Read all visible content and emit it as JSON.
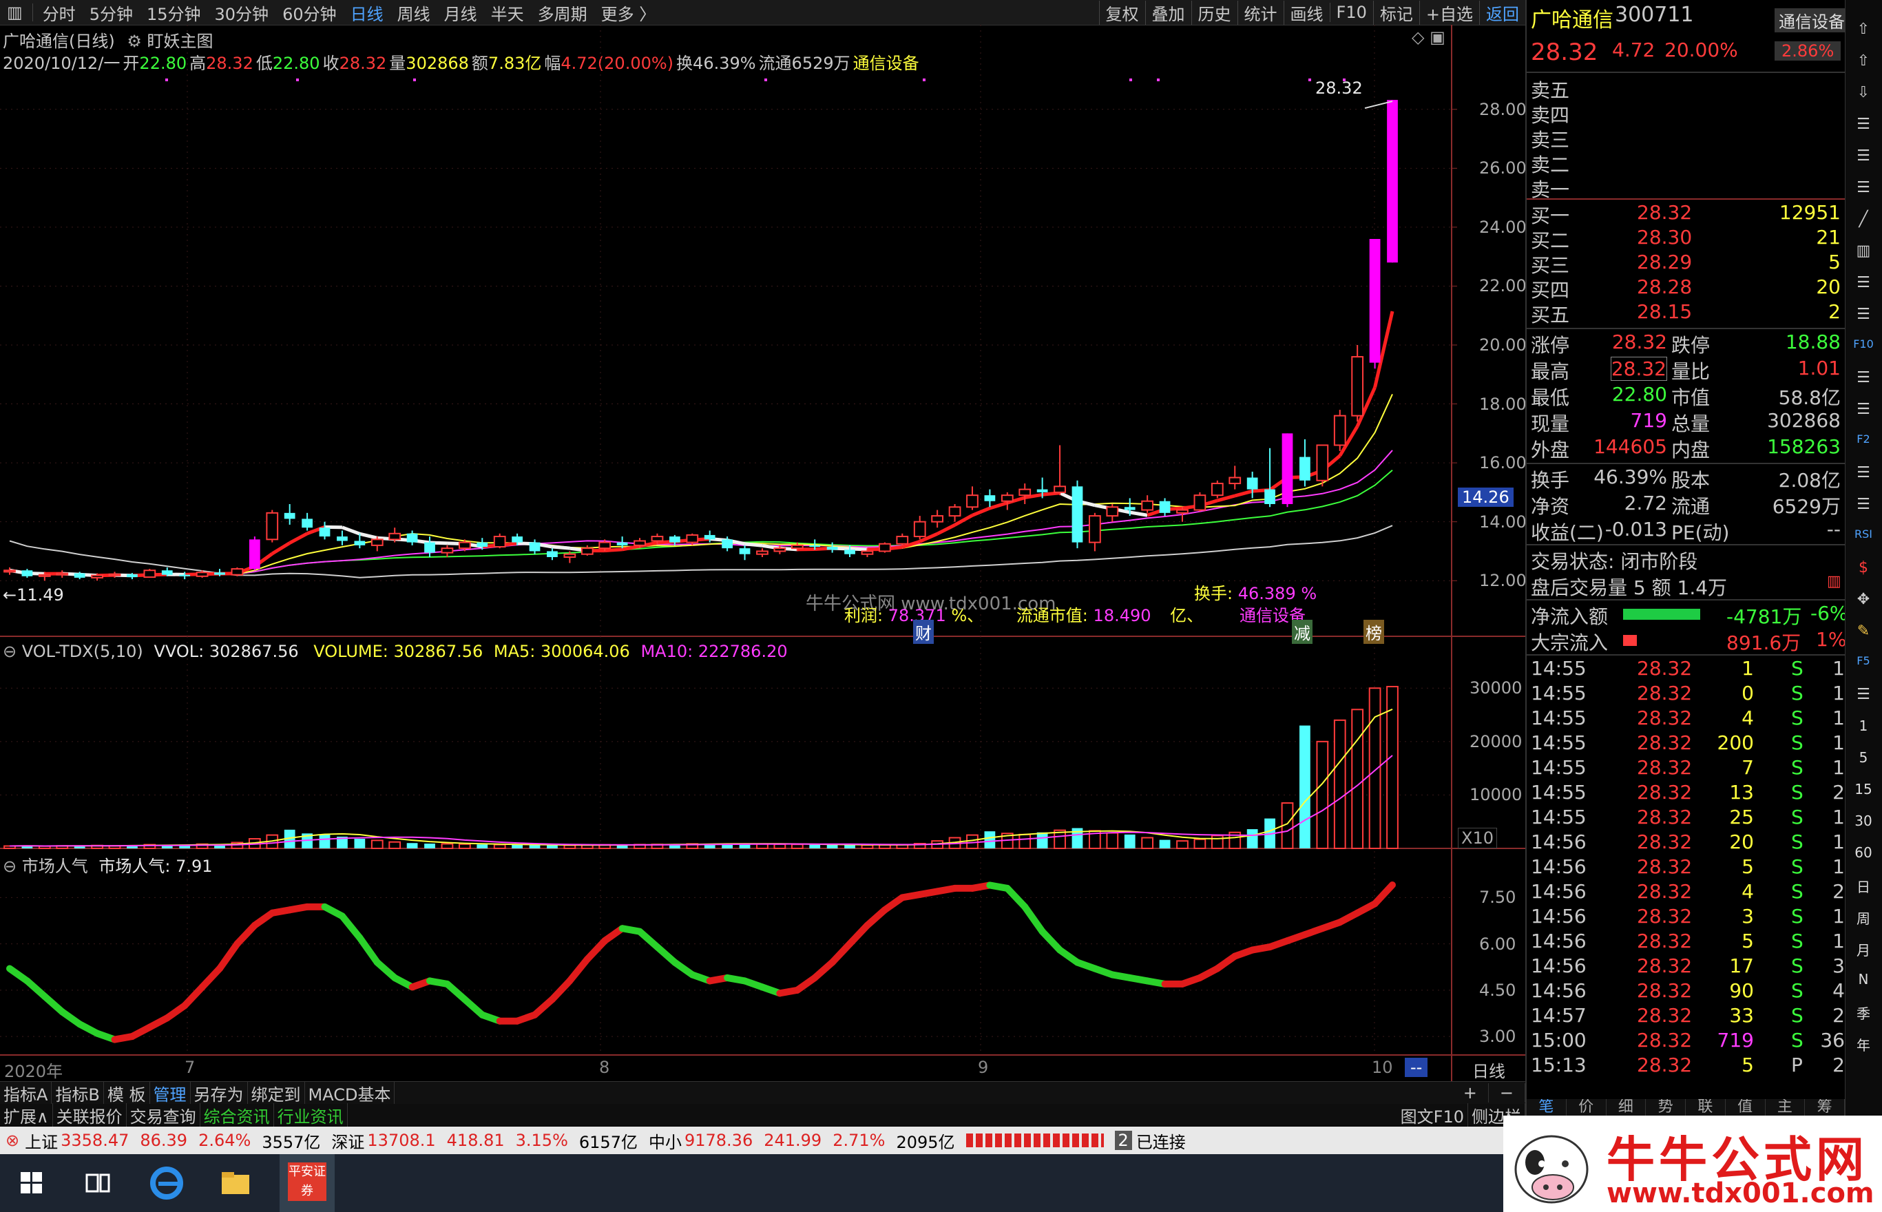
{
  "menu": {
    "left_icon": "▥",
    "tabs": [
      "分时",
      "5分钟",
      "15分钟",
      "30分钟",
      "60分钟",
      "日线",
      "周线",
      "月线",
      "半天",
      "多周期",
      "更多 〉"
    ],
    "active": "日线",
    "tools": [
      "复权",
      "叠加",
      "历史",
      "统计",
      "画线",
      "F10",
      "标记",
      "+自选",
      "返回"
    ]
  },
  "chart": {
    "title": "广哈通信(日线)",
    "indicator": "盯妖主图",
    "info": {
      "date": "2020/10/12/一",
      "open_label": "开",
      "open": "22.80",
      "high_label": "高",
      "high": "28.32",
      "low_label": "低",
      "low": "22.80",
      "close_label": "收",
      "close": "28.32",
      "vol_label": "量",
      "vol": "302868",
      "amt_label": "额",
      "amt": "7.83亿",
      "amp_label": "幅",
      "amp": "4.72(20.00%)",
      "turnover": "换46.39%",
      "float": "流通6529万",
      "sector": "通信设备"
    },
    "price_ticks": [
      "28.00",
      "26.00",
      "24.00",
      "22.00",
      "20.00",
      "18.00",
      "16.00",
      "14.00",
      "12.00"
    ],
    "current_price_tag": "14.26",
    "max_label": "28.32",
    "min_label": "11.49",
    "overlay": {
      "profit_label": "利润:",
      "profit": "78.371",
      "profit_unit": "%、",
      "float_cap_label": "流通市值:",
      "float_cap": "18.490",
      "float_cap_unit": "亿、",
      "turnover_label": "换手:",
      "turnover": "46.389",
      "turnover_unit": "%",
      "sector": "通信设备",
      "watermark": "牛牛公式网 www.tdx001.com",
      "tag_cai": "财",
      "tag_jian": "减",
      "tag_bang": "榜"
    }
  },
  "vol": {
    "name": "VOL-TDX(5,10)",
    "vvol": "VVOL: 302867.56",
    "volume": "VOLUME: 302867.56",
    "ma5": "MA5: 300064.06",
    "ma10": "MA10: 222786.20",
    "ticks": [
      "30000",
      "20000",
      "10000"
    ],
    "unit": "X10"
  },
  "pop": {
    "name": "市场人气",
    "value": "市场人气: 7.91",
    "ticks": [
      "7.50",
      "6.00",
      "4.50",
      "3.00"
    ]
  },
  "xaxis": {
    "labels": [
      "2020年",
      "7",
      "8",
      "9",
      "10"
    ],
    "end": "--"
  },
  "period_label": "日线",
  "bottom_tabs": [
    "指标A",
    "指标B",
    "模 板",
    "管理",
    "另存为",
    "绑定到",
    "MACD基本"
  ],
  "bottom_tabs_sel": "管理",
  "bottom_tabs2": [
    "扩展∧",
    "关联报价",
    "交易查询",
    "综合资讯",
    "行业资讯"
  ],
  "bottom_right": [
    "图文F10",
    "侧边栏"
  ],
  "plusminus": [
    "+",
    "−"
  ],
  "quote": {
    "name": "广哈通信",
    "code": "300711",
    "sector_btn": "通信设备",
    "price": "28.32",
    "chg": "4.72",
    "pct": "20.00%",
    "sector_pct": "2.86%",
    "asks": [
      "卖五",
      "卖四",
      "卖三",
      "卖二",
      "卖一"
    ],
    "bids": [
      {
        "l": "买一",
        "p": "28.32",
        "v": "12951"
      },
      {
        "l": "买二",
        "p": "28.30",
        "v": "21"
      },
      {
        "l": "买三",
        "p": "28.29",
        "v": "5"
      },
      {
        "l": "买四",
        "p": "28.28",
        "v": "20"
      },
      {
        "l": "买五",
        "p": "28.15",
        "v": "2"
      }
    ],
    "stats": [
      {
        "a": "涨停",
        "b": "28.32",
        "c": "跌停",
        "d": "18.88"
      },
      {
        "a": "最高",
        "b": "28.32",
        "c": "量比",
        "d": "1.01"
      },
      {
        "a": "最低",
        "b": "22.80",
        "c": "市值",
        "d": "58.8亿"
      },
      {
        "a": "现量",
        "b": "719",
        "c": "总量",
        "d": "302868"
      },
      {
        "a": "外盘",
        "b": "144605",
        "c": "内盘",
        "d": "158263"
      }
    ],
    "stats2": [
      {
        "a": "换手",
        "b": "46.39%",
        "c": "股本",
        "d": "2.08亿"
      },
      {
        "a": "净资",
        "b": "2.72",
        "c": "流通",
        "d": "6529万"
      },
      {
        "a": "收益(二)",
        "b": "-0.013",
        "c": "PE(动)",
        "d": "--"
      }
    ],
    "trade_status": "交易状态: 闭市阶段",
    "after_trade": "盘后交易量 5 额 1.4万",
    "netflow_label": "净流入额",
    "netflow": "-4781万",
    "netflow_pct": "-6%",
    "block_label": "大宗流入",
    "block": "891.6万",
    "block_pct": "1%",
    "ticks": [
      {
        "t": "14:55",
        "p": "28.32",
        "v": "1",
        "s": "S",
        "n": "1"
      },
      {
        "t": "14:55",
        "p": "28.32",
        "v": "0",
        "s": "S",
        "n": "1"
      },
      {
        "t": "14:55",
        "p": "28.32",
        "v": "4",
        "s": "S",
        "n": "1"
      },
      {
        "t": "14:55",
        "p": "28.32",
        "v": "200",
        "s": "S",
        "n": "1"
      },
      {
        "t": "14:55",
        "p": "28.32",
        "v": "7",
        "s": "S",
        "n": "1"
      },
      {
        "t": "14:55",
        "p": "28.32",
        "v": "13",
        "s": "S",
        "n": "2"
      },
      {
        "t": "14:55",
        "p": "28.32",
        "v": "25",
        "s": "S",
        "n": "1"
      },
      {
        "t": "14:56",
        "p": "28.32",
        "v": "20",
        "s": "S",
        "n": "1"
      },
      {
        "t": "14:56",
        "p": "28.32",
        "v": "5",
        "s": "S",
        "n": "1"
      },
      {
        "t": "14:56",
        "p": "28.32",
        "v": "4",
        "s": "S",
        "n": "2"
      },
      {
        "t": "14:56",
        "p": "28.32",
        "v": "3",
        "s": "S",
        "n": "1"
      },
      {
        "t": "14:56",
        "p": "28.32",
        "v": "5",
        "s": "S",
        "n": "1"
      },
      {
        "t": "14:56",
        "p": "28.32",
        "v": "17",
        "s": "S",
        "n": "3"
      },
      {
        "t": "14:56",
        "p": "28.32",
        "v": "90",
        "s": "S",
        "n": "4"
      },
      {
        "t": "14:57",
        "p": "28.32",
        "v": "33",
        "s": "S",
        "n": "2"
      },
      {
        "t": "15:00",
        "p": "28.32",
        "v": "719",
        "s": "S",
        "n": "36"
      },
      {
        "t": "15:13",
        "p": "28.32",
        "v": "5",
        "s": "P",
        "n": "2"
      }
    ],
    "bottom_tabs": [
      "笔",
      "价",
      "细",
      "势",
      "联",
      "值",
      "主",
      "筹"
    ]
  },
  "side_tools": [
    "⇧",
    "⇧",
    "⇩",
    "☰",
    "☰",
    "☰",
    "╱",
    "▥",
    "☰",
    "☰",
    "F10",
    "☰",
    "☰",
    "F2",
    "☰",
    "☰",
    "RSI",
    "$",
    "✥",
    "✎",
    "F5",
    "☰",
    "1",
    "5",
    "15",
    "30",
    "60",
    "日",
    "周",
    "月",
    "N",
    "季",
    "年"
  ],
  "status": {
    "sh_label": "上证",
    "sh": "3358.47",
    "sh_chg": "86.39",
    "sh_pct": "2.64%",
    "sh_amt": "3557亿",
    "sz_label": "深证",
    "sz": "13708.1",
    "sz_chg": "418.81",
    "sz_pct": "3.15%",
    "sz_amt": "6157亿",
    "zx_label": "中小",
    "zx": "9178.36",
    "zx_chg": "241.99",
    "zx_pct": "2.71%",
    "zx_amt": "2095亿",
    "conn_num": "2",
    "conn": "已连接"
  },
  "brand": {
    "name": "牛牛公式网",
    "url": "www.tdx001.com"
  },
  "taskbar": {
    "app_label": "平安证券"
  },
  "colors": {
    "up": "#ff3b3b",
    "down": "#54ffff",
    "ma_white": "#e8e8e8",
    "ma_yellow": "#ffff3c",
    "ma_magenta": "#ff3cff",
    "ma_green": "#3cff3c",
    "limit": "#ff00ff",
    "accent": "#4fa3ff"
  },
  "chart_data": {
    "type": "candlestick",
    "price_axis": [
      11,
      29
    ],
    "candles": [
      [
        12.3,
        12.45,
        12.2,
        12.35
      ],
      [
        12.35,
        12.4,
        12.1,
        12.15
      ],
      [
        12.15,
        12.3,
        12.0,
        12.2
      ],
      [
        12.2,
        12.35,
        12.1,
        12.25
      ],
      [
        12.25,
        12.3,
        12.05,
        12.1
      ],
      [
        12.1,
        12.25,
        12.0,
        12.18
      ],
      [
        12.18,
        12.3,
        12.1,
        12.22
      ],
      [
        12.22,
        12.26,
        12.05,
        12.12
      ],
      [
        12.12,
        12.4,
        12.1,
        12.35
      ],
      [
        12.35,
        12.45,
        12.15,
        12.2
      ],
      [
        12.2,
        12.3,
        12.05,
        12.15
      ],
      [
        12.15,
        12.35,
        12.1,
        12.28
      ],
      [
        12.28,
        12.4,
        12.15,
        12.2
      ],
      [
        12.2,
        12.45,
        12.15,
        12.4
      ],
      [
        12.4,
        13.5,
        12.35,
        13.4
      ],
      [
        13.4,
        14.4,
        13.3,
        14.3
      ],
      [
        14.3,
        14.6,
        13.9,
        14.1
      ],
      [
        14.1,
        14.3,
        13.7,
        13.8
      ],
      [
        13.8,
        14.0,
        13.4,
        13.5
      ],
      [
        13.5,
        13.7,
        13.2,
        13.35
      ],
      [
        13.35,
        13.6,
        13.1,
        13.2
      ],
      [
        13.2,
        13.5,
        13.0,
        13.4
      ],
      [
        13.4,
        13.8,
        13.3,
        13.6
      ],
      [
        13.6,
        13.7,
        13.2,
        13.3
      ],
      [
        13.3,
        13.5,
        12.8,
        12.95
      ],
      [
        12.95,
        13.2,
        12.8,
        13.1
      ],
      [
        13.1,
        13.4,
        13.0,
        13.3
      ],
      [
        13.3,
        13.45,
        13.05,
        13.15
      ],
      [
        13.15,
        13.6,
        13.1,
        13.5
      ],
      [
        13.5,
        13.6,
        13.2,
        13.3
      ],
      [
        13.3,
        13.4,
        12.9,
        13.0
      ],
      [
        13.0,
        13.1,
        12.7,
        12.8
      ],
      [
        12.8,
        13.0,
        12.6,
        12.9
      ],
      [
        12.9,
        13.2,
        12.85,
        13.1
      ],
      [
        13.1,
        13.4,
        13.0,
        13.3
      ],
      [
        13.3,
        13.5,
        13.1,
        13.2
      ],
      [
        13.2,
        13.45,
        13.1,
        13.35
      ],
      [
        13.35,
        13.6,
        13.25,
        13.5
      ],
      [
        13.5,
        13.55,
        13.2,
        13.3
      ],
      [
        13.3,
        13.6,
        13.2,
        13.55
      ],
      [
        13.55,
        13.7,
        13.3,
        13.4
      ],
      [
        13.4,
        13.5,
        13.0,
        13.1
      ],
      [
        13.1,
        13.2,
        12.7,
        12.9
      ],
      [
        12.9,
        13.1,
        12.8,
        13.0
      ],
      [
        13.0,
        13.2,
        12.9,
        13.1
      ],
      [
        13.1,
        13.3,
        13.0,
        13.2
      ],
      [
        13.2,
        13.4,
        13.05,
        13.15
      ],
      [
        13.15,
        13.3,
        12.95,
        13.05
      ],
      [
        13.05,
        13.2,
        12.8,
        12.9
      ],
      [
        12.9,
        13.1,
        12.8,
        13.0
      ],
      [
        13.0,
        13.3,
        12.95,
        13.25
      ],
      [
        13.25,
        13.6,
        13.2,
        13.5
      ],
      [
        13.5,
        14.2,
        13.4,
        14.0
      ],
      [
        14.0,
        14.4,
        13.8,
        14.2
      ],
      [
        14.2,
        14.6,
        14.0,
        14.5
      ],
      [
        14.5,
        15.2,
        14.4,
        14.9
      ],
      [
        14.9,
        15.1,
        14.5,
        14.7
      ],
      [
        14.7,
        15.0,
        14.4,
        14.9
      ],
      [
        14.9,
        15.3,
        14.6,
        15.1
      ],
      [
        15.1,
        15.5,
        14.8,
        15.0
      ],
      [
        15.0,
        16.6,
        14.9,
        15.2
      ],
      [
        15.2,
        15.4,
        13.1,
        13.3
      ],
      [
        13.3,
        14.3,
        13.0,
        14.2
      ],
      [
        14.2,
        14.6,
        14.0,
        14.5
      ],
      [
        14.5,
        14.8,
        14.2,
        14.4
      ],
      [
        14.4,
        14.9,
        14.3,
        14.7
      ],
      [
        14.7,
        14.8,
        14.2,
        14.3
      ],
      [
        14.3,
        14.5,
        14.0,
        14.4
      ],
      [
        14.4,
        15.0,
        14.35,
        14.9
      ],
      [
        14.9,
        15.4,
        14.8,
        15.3
      ],
      [
        15.3,
        15.9,
        15.1,
        15.5
      ],
      [
        15.5,
        15.7,
        14.8,
        15.1
      ],
      [
        15.1,
        16.5,
        14.5,
        14.6
      ],
      [
        14.6,
        17.0,
        14.5,
        17.0
      ],
      [
        16.2,
        16.8,
        15.2,
        15.4
      ],
      [
        15.4,
        16.6,
        15.2,
        16.6
      ],
      [
        16.6,
        17.8,
        16.4,
        17.6
      ],
      [
        17.6,
        20.0,
        17.4,
        19.6
      ],
      [
        19.4,
        23.6,
        19.2,
        23.6
      ],
      [
        22.8,
        28.32,
        22.8,
        28.32
      ]
    ],
    "volumes": [
      450,
      500,
      420,
      480,
      520,
      550,
      480,
      600,
      700,
      650,
      720,
      800,
      750,
      1100,
      1800,
      2500,
      3500,
      2800,
      2600,
      2200,
      1800,
      1500,
      1200,
      1000,
      900,
      850,
      800,
      750,
      700,
      650,
      620,
      600,
      580,
      620,
      680,
      700,
      720,
      750,
      800,
      850,
      900,
      950,
      880,
      820,
      780,
      750,
      700,
      680,
      650,
      620,
      650,
      700,
      900,
      1400,
      2000,
      2500,
      3200,
      2800,
      2600,
      3000,
      3400,
      3800,
      3300,
      2900,
      2600,
      2000,
      1600,
      1400,
      1700,
      2400,
      3000,
      3600,
      5600,
      8500,
      23000,
      20000,
      24000,
      26000,
      30000,
      30287
    ],
    "popularity": [
      5.2,
      4.8,
      4.3,
      3.8,
      3.4,
      3.1,
      2.9,
      3.0,
      3.3,
      3.6,
      4.0,
      4.6,
      5.2,
      6.0,
      6.6,
      7.0,
      7.1,
      7.2,
      7.2,
      6.9,
      6.2,
      5.4,
      4.9,
      4.6,
      4.8,
      4.7,
      4.2,
      3.7,
      3.5,
      3.5,
      3.7,
      4.2,
      4.8,
      5.5,
      6.1,
      6.5,
      6.4,
      5.9,
      5.4,
      5.0,
      4.8,
      4.9,
      4.8,
      4.6,
      4.4,
      4.5,
      4.9,
      5.4,
      6.0,
      6.6,
      7.1,
      7.5,
      7.6,
      7.7,
      7.8,
      7.8,
      7.9,
      7.8,
      7.2,
      6.4,
      5.8,
      5.4,
      5.2,
      5.0,
      4.9,
      4.8,
      4.7,
      4.7,
      4.9,
      5.2,
      5.6,
      5.8,
      5.9,
      6.1,
      6.3,
      6.5,
      6.7,
      7.0,
      7.3,
      7.91
    ]
  }
}
